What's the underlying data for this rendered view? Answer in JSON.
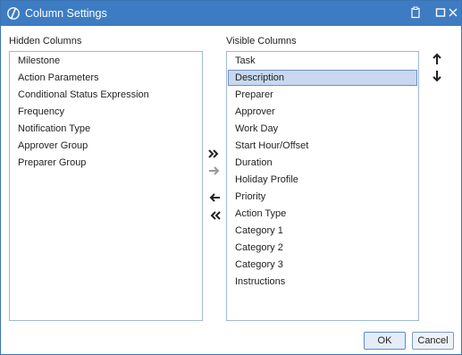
{
  "window": {
    "title": "Column Settings",
    "accent": "#3d7cc2"
  },
  "hidden_columns": {
    "label": "Hidden Columns",
    "items": [
      "Milestone",
      "Action Parameters",
      "Conditional Status Expression",
      "Frequency",
      "Notification Type",
      "Approver Group",
      "Preparer Group"
    ]
  },
  "visible_columns": {
    "label": "Visible Columns",
    "selected": "Description",
    "items": [
      "Task",
      "Description",
      "Preparer",
      "Approver",
      "Work Day",
      "Start Hour/Offset",
      "Duration",
      "Holiday Profile",
      "Priority",
      "Action Type",
      "Category 1",
      "Category 2",
      "Category 3",
      "Instructions"
    ]
  },
  "transfer_buttons": {
    "move_all_right_icon": "double-arrow-right-icon",
    "move_right_icon": "arrow-right-icon",
    "move_left_icon": "arrow-left-icon",
    "move_all_left_icon": "double-arrow-left-icon"
  },
  "footer": {
    "ok_label": "OK",
    "cancel_label": "Cancel"
  }
}
